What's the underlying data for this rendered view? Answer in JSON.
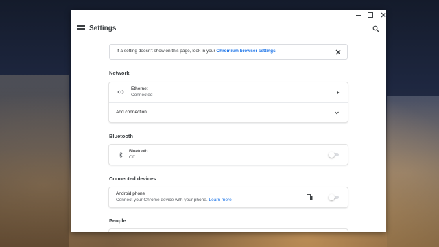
{
  "window": {
    "title": "Settings"
  },
  "banner": {
    "text": "If a setting doesn't show on this page, look in your ",
    "link": "Chromium browser settings"
  },
  "sections": {
    "network": {
      "title": "Network",
      "ethernet_title": "Ethernet",
      "ethernet_status": "Connected",
      "add_connection": "Add connection"
    },
    "bluetooth": {
      "title": "Bluetooth",
      "item_title": "Bluetooth",
      "item_status": "Off",
      "enabled": false
    },
    "connected_devices": {
      "title": "Connected devices",
      "item_title": "Android phone",
      "item_desc": "Connect your Chrome device with your phone.",
      "item_link": "Learn more",
      "enabled": false
    },
    "people": {
      "title": "People"
    }
  },
  "icons": {
    "menu": "menu-icon",
    "search": "search-icon",
    "close": "close-icon",
    "ethernet": "ethernet-icon",
    "bluetooth": "bluetooth-icon",
    "phone": "phone-icon"
  },
  "colors": {
    "accent": "#1a73e8",
    "text": "#202124",
    "secondary_text": "#5f6368"
  }
}
